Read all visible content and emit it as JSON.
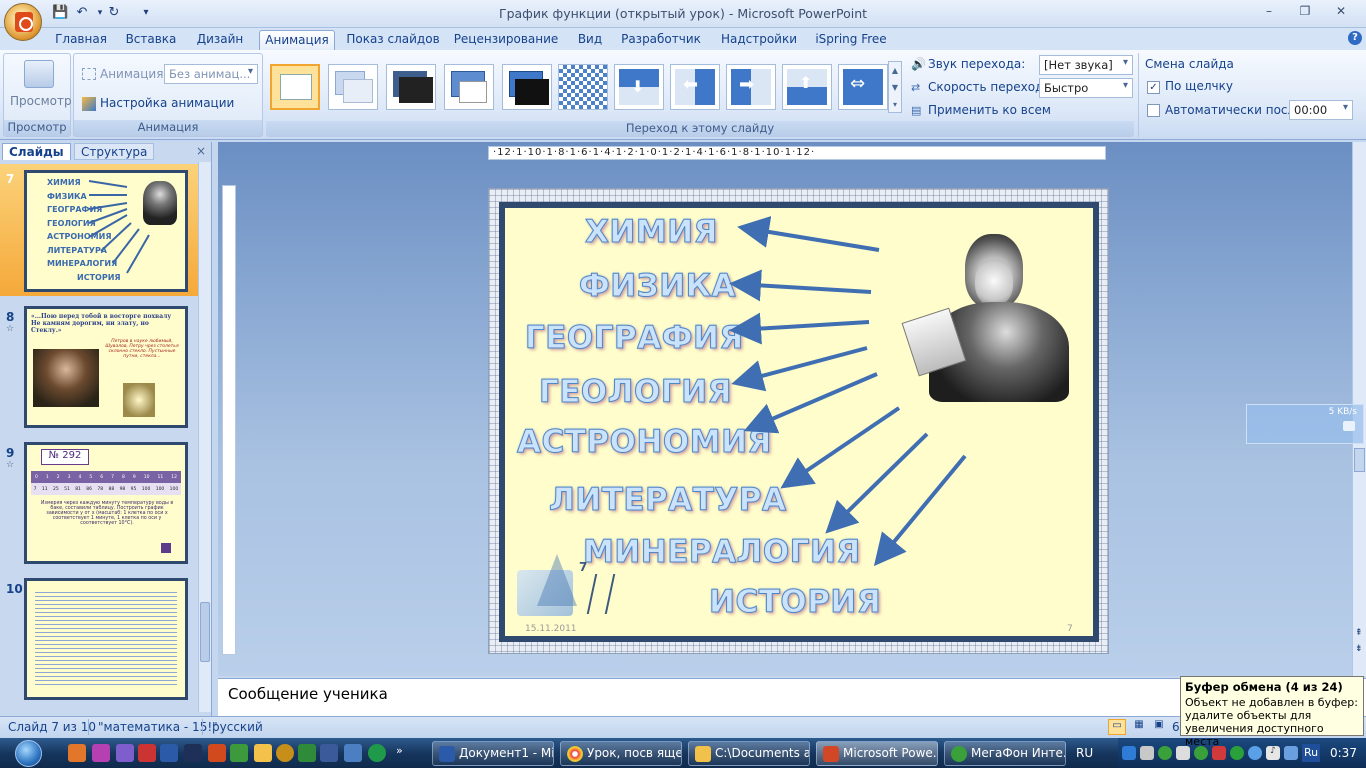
{
  "window": {
    "title": "График функции (открытый урок) - Microsoft PowerPoint"
  },
  "ribbon": {
    "tabs": [
      "Главная",
      "Вставка",
      "Дизайн",
      "Анимация",
      "Показ слайдов",
      "Рецензирование",
      "Вид",
      "Разработчик",
      "Надстройки",
      "iSpring Free"
    ],
    "active_tab": "Анимация",
    "preview": {
      "button": "Просмотр",
      "group": "Просмотр"
    },
    "animation": {
      "label": "Анимация:",
      "value": "Без анимац...",
      "custom": "Настройка анимации",
      "group": "Анимация"
    },
    "transition": {
      "group": "Переход к этому слайду",
      "sound_label": "Звук перехода:",
      "sound_value": "[Нет звука]",
      "speed_label": "Скорость перехода:",
      "speed_value": "Быстро",
      "apply_all": "Применить ко всем"
    },
    "advance": {
      "title": "Смена слайда",
      "on_click": "По щелчку",
      "on_click_checked": true,
      "auto_label": "Автоматически после:",
      "auto_checked": false,
      "auto_value": "00:00"
    }
  },
  "left_panel": {
    "tabs": [
      "Слайды",
      "Структура"
    ],
    "slides": [
      {
        "num": "7",
        "selected": true,
        "words": [
          "ХИМИЯ",
          "ФИЗИКА",
          "ГЕОГРАФИЯ",
          "ГЕОЛОГИЯ",
          "АСТРОНОМИЯ",
          "ЛИТЕРАТУРА",
          "МИНЕРАЛОГИЯ",
          "ИСТОРИЯ"
        ]
      },
      {
        "num": "8",
        "quote": "«...Пою перед тобой в восторге похвалу Не камням дорогим, ни злату, но Стеклу.»",
        "text": "Петров в науке любимый, Шувалов, Петру чрез столетья склонно стекло. Пустынные путни, стекла..."
      },
      {
        "num": "9",
        "task": "№ 292",
        "table_x": [
          "0",
          "1",
          "2",
          "3",
          "4",
          "5",
          "6",
          "7",
          "8",
          "9",
          "10",
          "11",
          "12"
        ],
        "table_y": [
          "7",
          "11",
          "25",
          "51",
          "81",
          "86",
          "78",
          "88",
          "98",
          "95",
          "100",
          "100",
          "100"
        ],
        "caption": "Измеряя через каждую минуту температуру воды в баке, составили таблицу. Построить график зависимости y от x (масштаб: 1 клетка по оси x соответствует 1 минуте, 1 клетка по оси y соответствует 10°С)."
      },
      {
        "num": "10"
      }
    ]
  },
  "ruler": {
    "h": "·12·1·10·1·8·1·6·1·4·1·2·1·0·1·2·1·4·1·6·1·8·1·10·1·12·"
  },
  "slide": {
    "words": [
      "ХИМИЯ",
      "ФИЗИКА",
      "ГЕОГРАФИЯ",
      "ГЕОЛОГИЯ",
      "АСТРОНОМИЯ",
      "ЛИТЕРАТУРА",
      "МИНЕРАЛОГИЯ",
      "ИСТОРИЯ"
    ],
    "date": "15.11.2011",
    "page": "7"
  },
  "notes": {
    "text": "Сообщение  ученика"
  },
  "status": {
    "slide": "Слайд 7 из 10",
    "theme": "\"математика - 15!\"",
    "lang": "русский",
    "zoom": "6"
  },
  "clipboard": {
    "title": "Буфер обмена (4 из 24)",
    "body": "Объект не добавлен в буфер: удалите объекты для увеличения доступного места"
  },
  "net_widget": {
    "speed": "5 KB/s"
  },
  "taskbar": {
    "items": [
      "Документ1 - Mi...",
      "Урок, посв яще...",
      "C:\\Documents a...",
      "Microsoft Powe...",
      "МегаФон Инте..."
    ],
    "lang": "RU",
    "tray_lang": "Ru",
    "clock": "0:37"
  }
}
